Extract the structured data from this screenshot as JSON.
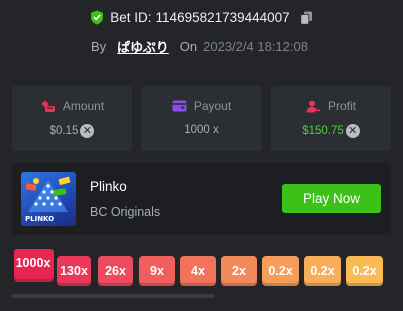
{
  "bet": {
    "label": "Bet ID:",
    "id": "114695821739444007"
  },
  "author": {
    "by_label": "By",
    "username": "ぱゆぷり",
    "on_label": "On",
    "date": "2023/2/4 18:12:08"
  },
  "stats": {
    "amount": {
      "label": "Amount",
      "value": "$0.15",
      "icon": "coins-icon",
      "color": "#e8315b"
    },
    "payout": {
      "label": "Payout",
      "value": "1000 x",
      "icon": "wallet-icon",
      "color": "#8b4dea"
    },
    "profit": {
      "label": "Profit",
      "value": "$150.75",
      "icon": "profit-user-icon",
      "color": "#e8315b"
    }
  },
  "game": {
    "name": "Plinko",
    "provider": "BC Originals",
    "play_label": "Play Now",
    "thumb_label": "PLINKO",
    "accent": "#3bc117"
  },
  "multipliers": [
    {
      "label": "1000x",
      "color": "#e6264f"
    },
    {
      "label": "130x",
      "color": "#e9385a"
    },
    {
      "label": "26x",
      "color": "#ec4a5e"
    },
    {
      "label": "9x",
      "color": "#ef5f5d"
    },
    {
      "label": "4x",
      "color": "#f1735c"
    },
    {
      "label": "2x",
      "color": "#f38a5c"
    },
    {
      "label": "0.2x",
      "color": "#f69d59"
    },
    {
      "label": "0.2x",
      "color": "#f8ae58"
    },
    {
      "label": "0.2x",
      "color": "#fabb55"
    }
  ]
}
